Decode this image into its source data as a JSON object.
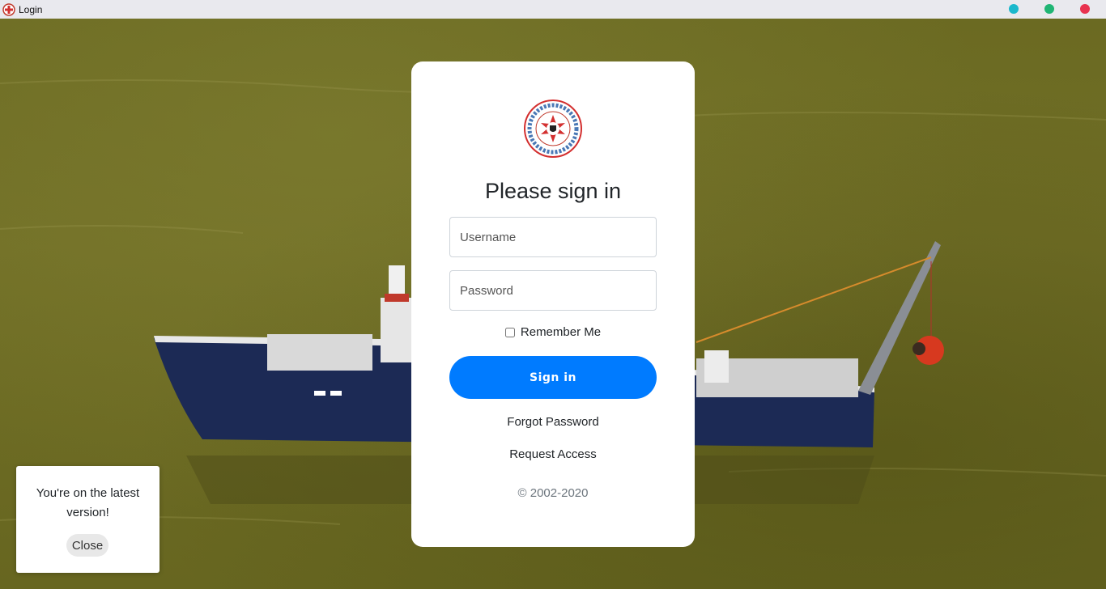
{
  "window": {
    "title": "Login",
    "controls": [
      "minimize",
      "maximize",
      "close"
    ]
  },
  "login": {
    "heading": "Please sign in",
    "username_placeholder": "Username",
    "password_placeholder": "Password",
    "remember_label": "Remember Me",
    "remember_checked": false,
    "signin_label": "Sign in",
    "forgot_label": "Forgot Password",
    "request_label": "Request Access",
    "copyright": "© 2002-2020"
  },
  "toast": {
    "message": "You're on the latest version!",
    "close_label": "Close"
  },
  "colors": {
    "primary": "#007bff",
    "titlebar": "#e9e9ee",
    "water": "#6b6a22",
    "dot_min": "#1bb8cc",
    "dot_max": "#20b574",
    "dot_close": "#e8334f"
  }
}
